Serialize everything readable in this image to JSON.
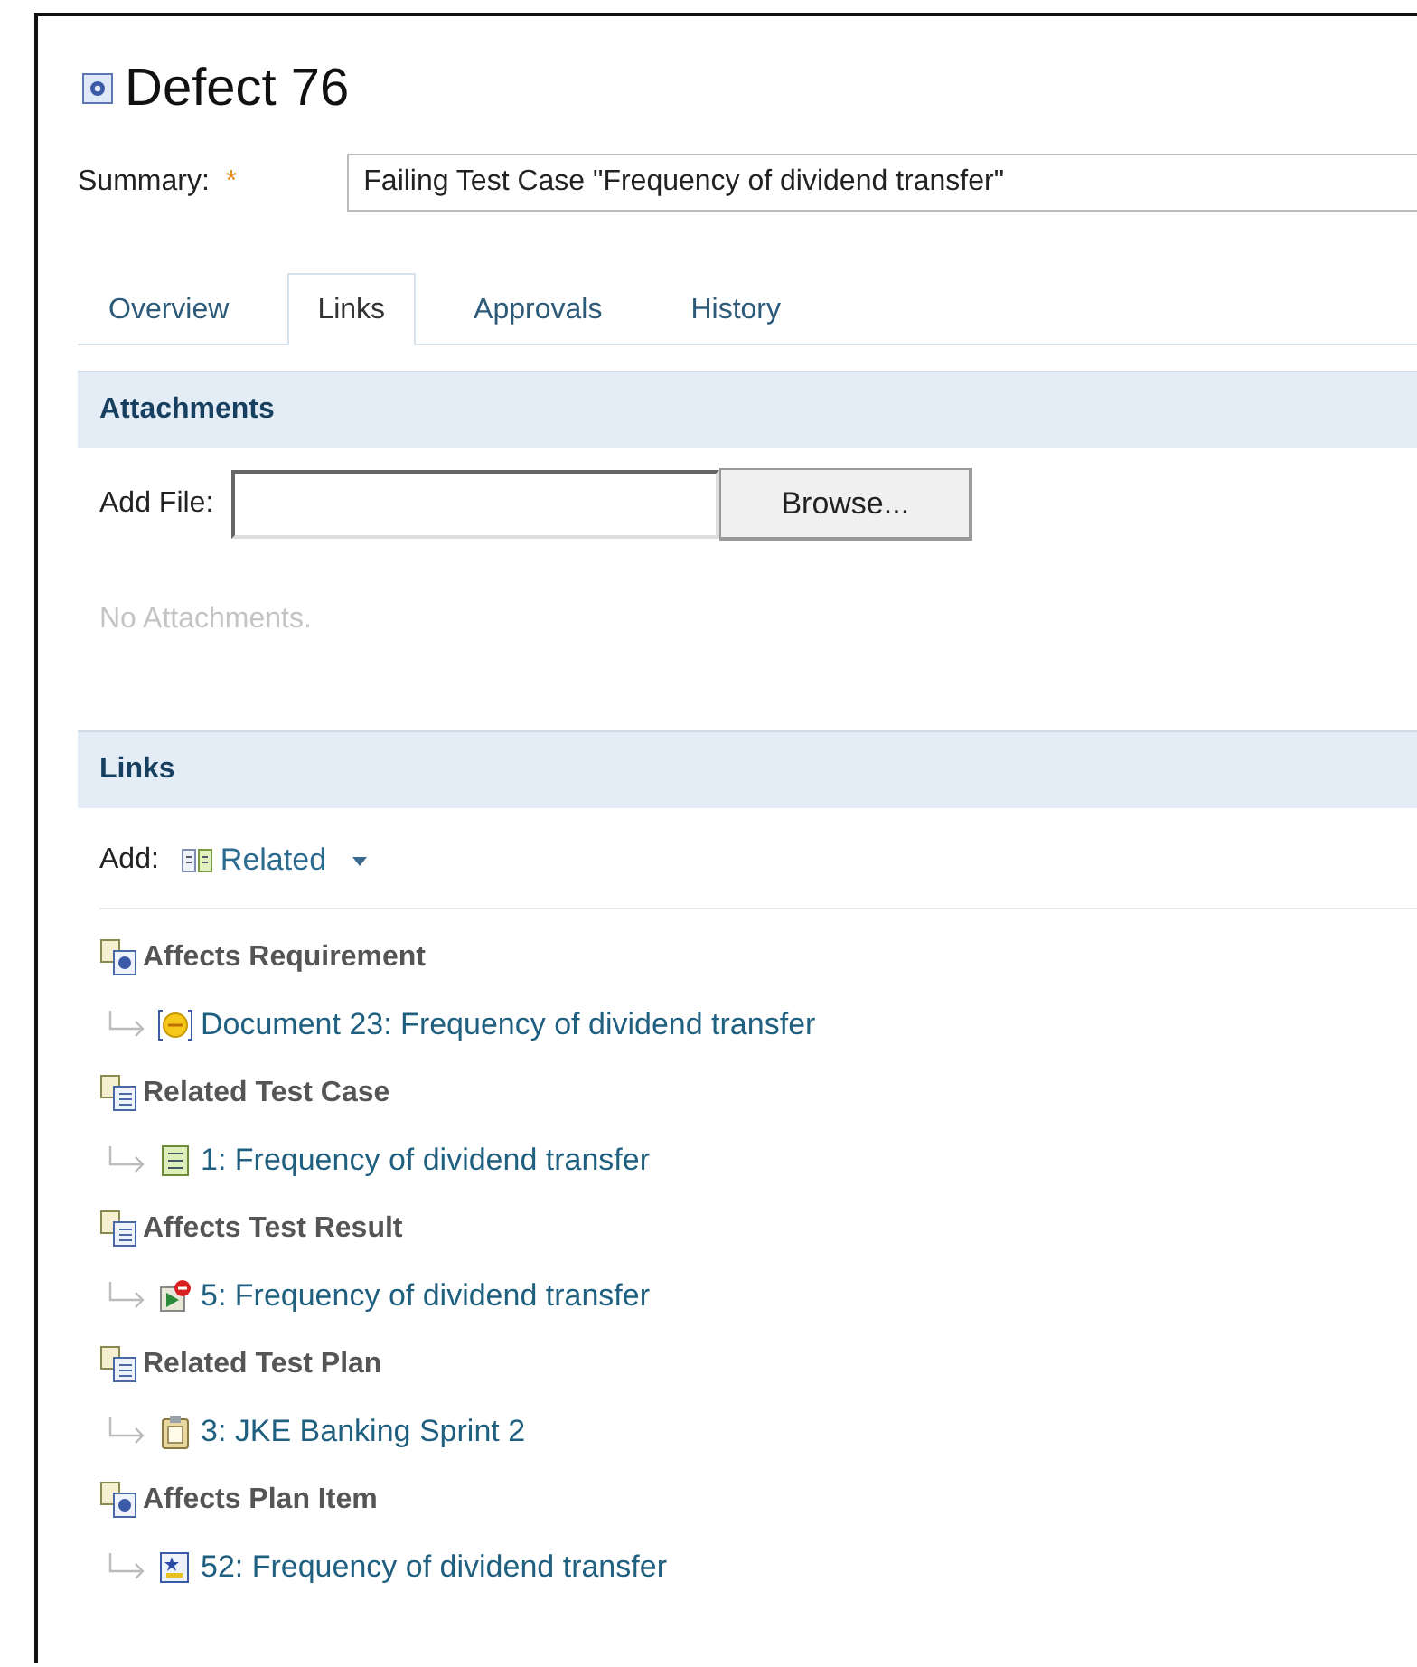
{
  "title": "Defect 76",
  "summary": {
    "label": "Summary:",
    "required_mark": "*",
    "value": "Failing Test Case \"Frequency of dividend transfer\""
  },
  "tabs": [
    {
      "label": "Overview",
      "selected": false
    },
    {
      "label": "Links",
      "selected": true
    },
    {
      "label": "Approvals",
      "selected": false
    },
    {
      "label": "History",
      "selected": false
    }
  ],
  "attachments": {
    "heading": "Attachments",
    "add_label": "Add File:",
    "browse_button": "Browse...",
    "empty_text": "No Attachments."
  },
  "links": {
    "heading": "Links",
    "add_label": "Add:",
    "add_menu": "Related",
    "groups": [
      {
        "label": "Affects Requirement",
        "children": [
          {
            "label": "Document 23: Frequency of dividend transfer"
          }
        ]
      },
      {
        "label": "Related Test Case",
        "children": [
          {
            "label": "1: Frequency of dividend transfer"
          }
        ]
      },
      {
        "label": "Affects Test Result",
        "children": [
          {
            "label": "5: Frequency of dividend transfer"
          }
        ]
      },
      {
        "label": "Related Test Plan",
        "children": [
          {
            "label": "3: JKE Banking Sprint 2"
          }
        ]
      },
      {
        "label": "Affects Plan Item",
        "children": [
          {
            "label": "52: Frequency of dividend transfer"
          }
        ]
      }
    ]
  }
}
